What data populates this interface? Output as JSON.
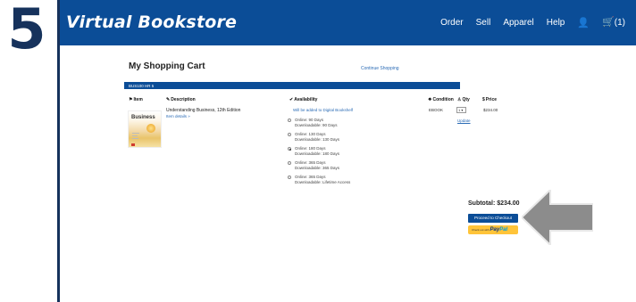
{
  "step_number": "5",
  "header": {
    "brand": "Virtual Bookstore",
    "menu": [
      "Order",
      "Sell",
      "Apparel",
      "Help"
    ],
    "user_icon": "user-icon",
    "cart_icon": "cart-icon",
    "cart_count": "(1)"
  },
  "cart": {
    "title": "My Shopping Cart",
    "continue_link": "Continue Shopping",
    "course": "BUS100   HR   5",
    "columns": {
      "item": "Item",
      "description": "Description",
      "availability": "Availability",
      "condition": "Condition",
      "qty": "Qty",
      "price": "Price"
    },
    "item": {
      "cover_title": "Business",
      "title": "Understanding Business, 12th Edition",
      "details_link": "Item details »",
      "availability_note": "Will be added to Digital Bookshelf",
      "condition": "EBOOK",
      "qty": "1",
      "update_link": "Update",
      "price": "$234.00",
      "options": [
        {
          "line1": "Online: 90 Days",
          "line2": "Downloadable: 90 Days",
          "selected": false
        },
        {
          "line1": "Online: 130 Days",
          "line2": "Downloadable: 130 Days",
          "selected": false
        },
        {
          "line1": "Online: 180 Days",
          "line2": "Downloadable: 180 Days",
          "selected": true
        },
        {
          "line1": "Online: 365 Days",
          "line2": "Downloadable: 365 Days",
          "selected": false
        },
        {
          "line1": "Online: 365 Days",
          "line2": "Downloadable: Lifetime Access",
          "selected": false
        }
      ]
    },
    "subtotal": "Subtotal: $234.00",
    "checkout_button": "Proceed to Checkout",
    "paypal_prefix": "Check out with",
    "paypal_brand": "Pay",
    "paypal_brand2": "Pal"
  },
  "colors": {
    "nav": "#0b4d97",
    "step": "#16325c",
    "arrow": "#8c8c8c",
    "paypal": "#ffc439"
  }
}
